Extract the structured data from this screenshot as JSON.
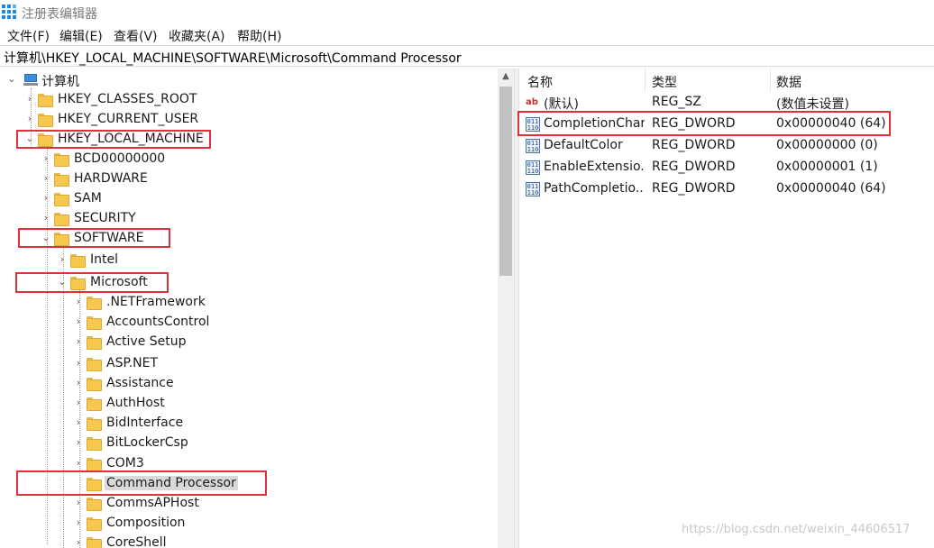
{
  "window": {
    "title": "注册表编辑器"
  },
  "menu": {
    "file": "文件(F)",
    "edit": "编辑(E)",
    "view": "查看(V)",
    "favorites": "收藏夹(A)",
    "help": "帮助(H)"
  },
  "address": {
    "path": "计算机\\HKEY_LOCAL_MACHINE\\SOFTWARE\\Microsoft\\Command Processor"
  },
  "tree": {
    "root": "计算机",
    "hkcr": "HKEY_CLASSES_ROOT",
    "hkcu": "HKEY_CURRENT_USER",
    "hklm": "HKEY_LOCAL_MACHINE",
    "bcd": "BCD00000000",
    "hardware": "HARDWARE",
    "sam": "SAM",
    "security": "SECURITY",
    "software": "SOFTWARE",
    "intel": "Intel",
    "microsoft": "Microsoft",
    "netframework": ".NETFramework",
    "accountscontrol": "AccountsControl",
    "activesetup": "Active Setup",
    "aspnet": "ASP.NET",
    "assistance": "Assistance",
    "authhost": "AuthHost",
    "bidinterface": "BidInterface",
    "bitlockercsp": "BitLockerCsp",
    "com3": "COM3",
    "commandprocessor": "Command Processor",
    "commsaphost": "CommsAPHost",
    "composition": "Composition",
    "coreshell": "CoreShell"
  },
  "list": {
    "headers": {
      "name": "名称",
      "type": "类型",
      "data": "数据"
    },
    "rows": [
      {
        "name": "(默认)",
        "type": "REG_SZ",
        "data": "(数值未设置)",
        "icon": "string-value-icon"
      },
      {
        "name": "CompletionChar",
        "type": "REG_DWORD",
        "data": "0x00000040 (64)",
        "icon": "binary-value-icon"
      },
      {
        "name": "DefaultColor",
        "type": "REG_DWORD",
        "data": "0x00000000 (0)",
        "icon": "binary-value-icon"
      },
      {
        "name": "EnableExtensio...",
        "type": "REG_DWORD",
        "data": "0x00000001 (1)",
        "icon": "binary-value-icon"
      },
      {
        "name": "PathCompletio...",
        "type": "REG_DWORD",
        "data": "0x00000040 (64)",
        "icon": "binary-value-icon"
      }
    ]
  },
  "icons": {
    "string_icon_text": "ab",
    "binary_icon_text": "011\n110"
  },
  "watermark": "https://blog.csdn.net/weixin_44606517",
  "colors": {
    "highlight": "#e0303a",
    "folder": "#f6c94e",
    "selection": "#d9d9d9"
  }
}
